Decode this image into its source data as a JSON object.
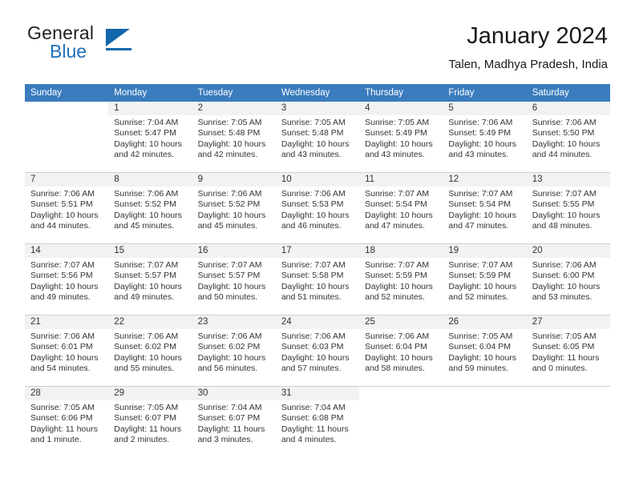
{
  "brand": {
    "word1": "General",
    "word2": "Blue",
    "triangle_color": "#1266ac",
    "blue_color": "#1d6fb8"
  },
  "header": {
    "title": "January 2024",
    "subtitle": "Talen, Madhya Pradesh, India"
  },
  "calendar": {
    "header_bg": "#3a7cbe",
    "daynum_bg": "#f2f2f2",
    "weekday_headers": [
      "Sunday",
      "Monday",
      "Tuesday",
      "Wednesday",
      "Thursday",
      "Friday",
      "Saturday"
    ],
    "weeks": [
      [
        {
          "day": "",
          "sunrise": "",
          "sunset": "",
          "daylight1": "",
          "daylight2": "",
          "blank": true
        },
        {
          "day": "1",
          "sunrise": "Sunrise: 7:04 AM",
          "sunset": "Sunset: 5:47 PM",
          "daylight1": "Daylight: 10 hours",
          "daylight2": "and 42 minutes."
        },
        {
          "day": "2",
          "sunrise": "Sunrise: 7:05 AM",
          "sunset": "Sunset: 5:48 PM",
          "daylight1": "Daylight: 10 hours",
          "daylight2": "and 42 minutes."
        },
        {
          "day": "3",
          "sunrise": "Sunrise: 7:05 AM",
          "sunset": "Sunset: 5:48 PM",
          "daylight1": "Daylight: 10 hours",
          "daylight2": "and 43 minutes."
        },
        {
          "day": "4",
          "sunrise": "Sunrise: 7:05 AM",
          "sunset": "Sunset: 5:49 PM",
          "daylight1": "Daylight: 10 hours",
          "daylight2": "and 43 minutes."
        },
        {
          "day": "5",
          "sunrise": "Sunrise: 7:06 AM",
          "sunset": "Sunset: 5:49 PM",
          "daylight1": "Daylight: 10 hours",
          "daylight2": "and 43 minutes."
        },
        {
          "day": "6",
          "sunrise": "Sunrise: 7:06 AM",
          "sunset": "Sunset: 5:50 PM",
          "daylight1": "Daylight: 10 hours",
          "daylight2": "and 44 minutes."
        }
      ],
      [
        {
          "day": "7",
          "sunrise": "Sunrise: 7:06 AM",
          "sunset": "Sunset: 5:51 PM",
          "daylight1": "Daylight: 10 hours",
          "daylight2": "and 44 minutes."
        },
        {
          "day": "8",
          "sunrise": "Sunrise: 7:06 AM",
          "sunset": "Sunset: 5:52 PM",
          "daylight1": "Daylight: 10 hours",
          "daylight2": "and 45 minutes."
        },
        {
          "day": "9",
          "sunrise": "Sunrise: 7:06 AM",
          "sunset": "Sunset: 5:52 PM",
          "daylight1": "Daylight: 10 hours",
          "daylight2": "and 45 minutes."
        },
        {
          "day": "10",
          "sunrise": "Sunrise: 7:06 AM",
          "sunset": "Sunset: 5:53 PM",
          "daylight1": "Daylight: 10 hours",
          "daylight2": "and 46 minutes."
        },
        {
          "day": "11",
          "sunrise": "Sunrise: 7:07 AM",
          "sunset": "Sunset: 5:54 PM",
          "daylight1": "Daylight: 10 hours",
          "daylight2": "and 47 minutes."
        },
        {
          "day": "12",
          "sunrise": "Sunrise: 7:07 AM",
          "sunset": "Sunset: 5:54 PM",
          "daylight1": "Daylight: 10 hours",
          "daylight2": "and 47 minutes."
        },
        {
          "day": "13",
          "sunrise": "Sunrise: 7:07 AM",
          "sunset": "Sunset: 5:55 PM",
          "daylight1": "Daylight: 10 hours",
          "daylight2": "and 48 minutes."
        }
      ],
      [
        {
          "day": "14",
          "sunrise": "Sunrise: 7:07 AM",
          "sunset": "Sunset: 5:56 PM",
          "daylight1": "Daylight: 10 hours",
          "daylight2": "and 49 minutes."
        },
        {
          "day": "15",
          "sunrise": "Sunrise: 7:07 AM",
          "sunset": "Sunset: 5:57 PM",
          "daylight1": "Daylight: 10 hours",
          "daylight2": "and 49 minutes."
        },
        {
          "day": "16",
          "sunrise": "Sunrise: 7:07 AM",
          "sunset": "Sunset: 5:57 PM",
          "daylight1": "Daylight: 10 hours",
          "daylight2": "and 50 minutes."
        },
        {
          "day": "17",
          "sunrise": "Sunrise: 7:07 AM",
          "sunset": "Sunset: 5:58 PM",
          "daylight1": "Daylight: 10 hours",
          "daylight2": "and 51 minutes."
        },
        {
          "day": "18",
          "sunrise": "Sunrise: 7:07 AM",
          "sunset": "Sunset: 5:59 PM",
          "daylight1": "Daylight: 10 hours",
          "daylight2": "and 52 minutes."
        },
        {
          "day": "19",
          "sunrise": "Sunrise: 7:07 AM",
          "sunset": "Sunset: 5:59 PM",
          "daylight1": "Daylight: 10 hours",
          "daylight2": "and 52 minutes."
        },
        {
          "day": "20",
          "sunrise": "Sunrise: 7:06 AM",
          "sunset": "Sunset: 6:00 PM",
          "daylight1": "Daylight: 10 hours",
          "daylight2": "and 53 minutes."
        }
      ],
      [
        {
          "day": "21",
          "sunrise": "Sunrise: 7:06 AM",
          "sunset": "Sunset: 6:01 PM",
          "daylight1": "Daylight: 10 hours",
          "daylight2": "and 54 minutes."
        },
        {
          "day": "22",
          "sunrise": "Sunrise: 7:06 AM",
          "sunset": "Sunset: 6:02 PM",
          "daylight1": "Daylight: 10 hours",
          "daylight2": "and 55 minutes."
        },
        {
          "day": "23",
          "sunrise": "Sunrise: 7:06 AM",
          "sunset": "Sunset: 6:02 PM",
          "daylight1": "Daylight: 10 hours",
          "daylight2": "and 56 minutes."
        },
        {
          "day": "24",
          "sunrise": "Sunrise: 7:06 AM",
          "sunset": "Sunset: 6:03 PM",
          "daylight1": "Daylight: 10 hours",
          "daylight2": "and 57 minutes."
        },
        {
          "day": "25",
          "sunrise": "Sunrise: 7:06 AM",
          "sunset": "Sunset: 6:04 PM",
          "daylight1": "Daylight: 10 hours",
          "daylight2": "and 58 minutes."
        },
        {
          "day": "26",
          "sunrise": "Sunrise: 7:05 AM",
          "sunset": "Sunset: 6:04 PM",
          "daylight1": "Daylight: 10 hours",
          "daylight2": "and 59 minutes."
        },
        {
          "day": "27",
          "sunrise": "Sunrise: 7:05 AM",
          "sunset": "Sunset: 6:05 PM",
          "daylight1": "Daylight: 11 hours",
          "daylight2": "and 0 minutes."
        }
      ],
      [
        {
          "day": "28",
          "sunrise": "Sunrise: 7:05 AM",
          "sunset": "Sunset: 6:06 PM",
          "daylight1": "Daylight: 11 hours",
          "daylight2": "and 1 minute."
        },
        {
          "day": "29",
          "sunrise": "Sunrise: 7:05 AM",
          "sunset": "Sunset: 6:07 PM",
          "daylight1": "Daylight: 11 hours",
          "daylight2": "and 2 minutes."
        },
        {
          "day": "30",
          "sunrise": "Sunrise: 7:04 AM",
          "sunset": "Sunset: 6:07 PM",
          "daylight1": "Daylight: 11 hours",
          "daylight2": "and 3 minutes."
        },
        {
          "day": "31",
          "sunrise": "Sunrise: 7:04 AM",
          "sunset": "Sunset: 6:08 PM",
          "daylight1": "Daylight: 11 hours",
          "daylight2": "and 4 minutes."
        },
        {
          "day": "",
          "sunrise": "",
          "sunset": "",
          "daylight1": "",
          "daylight2": "",
          "blank": true
        },
        {
          "day": "",
          "sunrise": "",
          "sunset": "",
          "daylight1": "",
          "daylight2": "",
          "blank": true
        },
        {
          "day": "",
          "sunrise": "",
          "sunset": "",
          "daylight1": "",
          "daylight2": "",
          "blank": true
        }
      ]
    ]
  }
}
